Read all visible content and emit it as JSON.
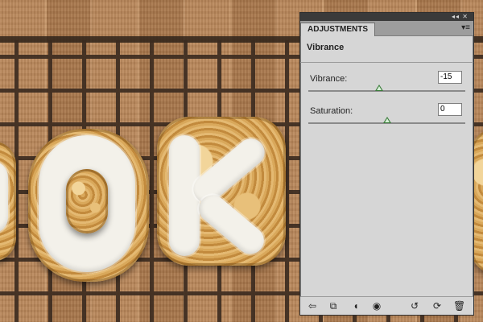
{
  "panel": {
    "tab_label": "ADJUSTMENTS",
    "titlebar_buttons": "◂◂ ✕",
    "menu_icon": "panel-menu-icon",
    "section_title": "Vibrance",
    "vibrance": {
      "label": "Vibrance:",
      "value": "-15",
      "slider_fraction": 0.45
    },
    "saturation": {
      "label": "Saturation:",
      "value": "0",
      "slider_fraction": 0.5
    },
    "footer_icons": [
      "back-arrow-icon",
      "clip-to-layer-icon",
      "mask-icon",
      "eye-icon",
      "view-previous-icon",
      "reset-icon",
      "trash-icon"
    ]
  },
  "colors": {
    "panel_bg": "#d6d6d6",
    "slider_thumb": "#3b7d3b",
    "wood": "#b9875a",
    "icing": "#f3f1ea"
  }
}
